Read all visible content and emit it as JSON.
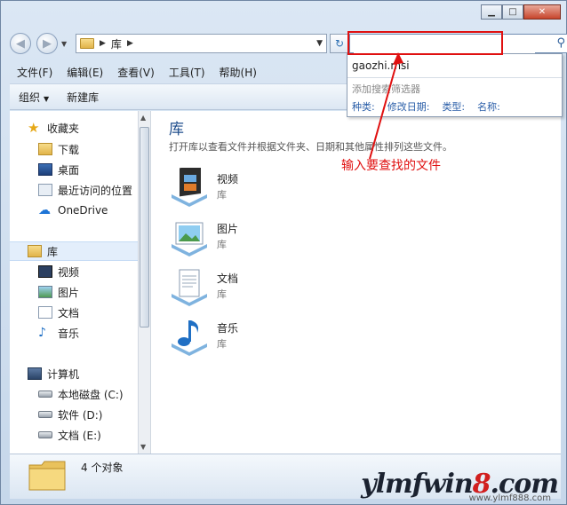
{
  "window": {
    "minimize": "▁",
    "maximize": "□",
    "close": "✕"
  },
  "address": {
    "path": "库",
    "search_placeholder": "",
    "search_value": ""
  },
  "menubar": [
    "文件(F)",
    "编辑(E)",
    "查看(V)",
    "工具(T)",
    "帮助(H)"
  ],
  "toolbar": {
    "organize": "组织",
    "new_library": "新建库"
  },
  "sidebar": {
    "favorites": {
      "label": "收藏夹",
      "items": [
        "下载",
        "桌面",
        "最近访问的位置",
        "OneDrive"
      ]
    },
    "libraries": {
      "label": "库",
      "items": [
        "视频",
        "图片",
        "文档",
        "音乐"
      ]
    },
    "computer": {
      "label": "计算机",
      "items": [
        "本地磁盘 (C:)",
        "软件 (D:)",
        "文档 (E:)"
      ]
    }
  },
  "main": {
    "title": "库",
    "subtitle": "打开库以查看文件并根据文件夹、日期和其他属性排列这些文件。",
    "items": [
      {
        "name": "视频",
        "type": "库"
      },
      {
        "name": "图片",
        "type": "库"
      },
      {
        "name": "文档",
        "type": "库"
      },
      {
        "name": "音乐",
        "type": "库"
      }
    ]
  },
  "status": {
    "count": "4 个对象"
  },
  "search_suggestions": {
    "recent": "gaozhi.msi",
    "add_filter": "添加搜索筛选器",
    "filters": [
      "种类:",
      "修改日期:",
      "类型:",
      "名称:"
    ]
  },
  "annotation": "输入要查找的文件",
  "watermark": {
    "brand_a": "ylmfwin",
    "brand_num": "8",
    "brand_b": ".com",
    "url": "www.ylmf888.com"
  },
  "colors": {
    "annotation_red": "#e01010",
    "title_blue": "#1e4d8c",
    "link_blue": "#2a5ea8"
  }
}
